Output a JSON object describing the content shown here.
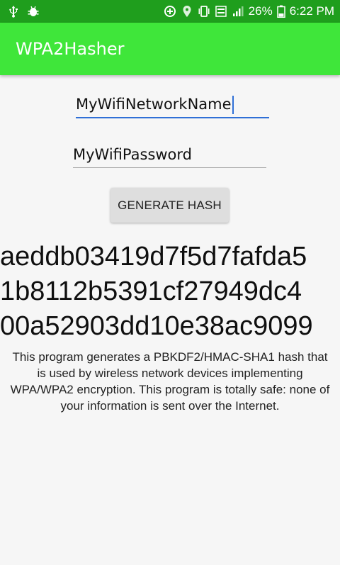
{
  "status_bar": {
    "battery_percent": "26%",
    "time": "6:22 PM",
    "icons": [
      "usb-icon",
      "android-debug-icon",
      "data-saver-icon",
      "location-icon",
      "vibrate-icon",
      "volte-icon",
      "signal-icon",
      "battery-icon"
    ]
  },
  "app_bar": {
    "title": "WPA2Hasher"
  },
  "form": {
    "ssid_value": "MyWifiNetworkName",
    "password_value": "MyWifiPassword",
    "generate_button_label": "GENERATE HASH"
  },
  "output": {
    "hash_lines": [
      "aeddb03419d7f5d7fafda5",
      "1b8112b5391cf27949dc4",
      "00a52903dd10e38ac9099"
    ]
  },
  "description": "This program generates a PBKDF2/HMAC-SHA1 hash that is used by wireless network devices implementing WPA/WPA2 encryption. This program is totally safe: none of your information is sent over the Internet.",
  "colors": {
    "status_bar": "#1f9e1d",
    "app_bar": "#3fe63a",
    "focus_accent": "#2f6fd6",
    "background": "#f6f6f6"
  }
}
